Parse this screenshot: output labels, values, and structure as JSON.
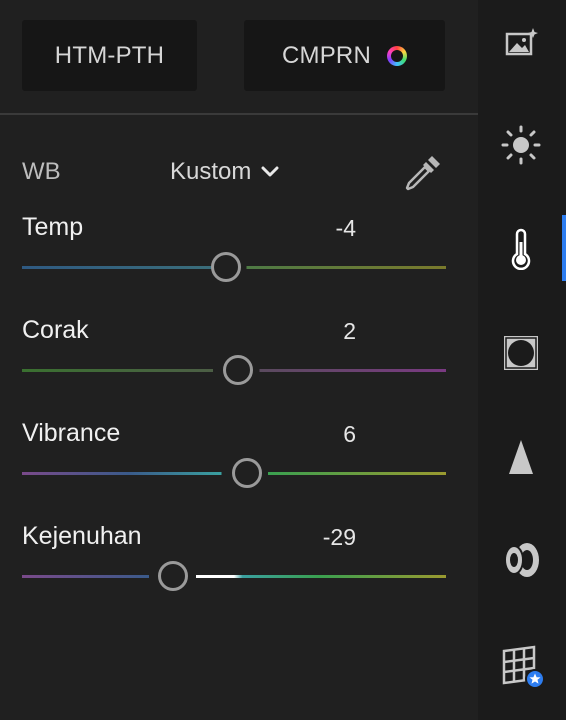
{
  "top_buttons": {
    "htm_pth_label": "HTM-PTH",
    "cmprn_label": "CMPRN"
  },
  "wb": {
    "label": "WB",
    "selected": "Kustom"
  },
  "sliders": [
    {
      "label": "Temp",
      "value": "-4",
      "level": 0.48
    },
    {
      "label": "Corak",
      "value": "2",
      "level": 0.51
    },
    {
      "label": "Vibrance",
      "value": "6",
      "level": 0.53
    },
    {
      "label": "Kejenuhan",
      "value": "-29",
      "level": 0.355
    }
  ],
  "rail": {
    "icons": [
      "image-sparkle-icon",
      "sun-icon",
      "thermometer-icon",
      "vignette-icon",
      "triangle-icon",
      "lens-icon",
      "grid-star-icon"
    ],
    "active": "thermometer-icon"
  },
  "colors": {
    "accent": "#2d7df0",
    "panel_bg": "#202020",
    "rail_bg": "#1b1b1b"
  }
}
